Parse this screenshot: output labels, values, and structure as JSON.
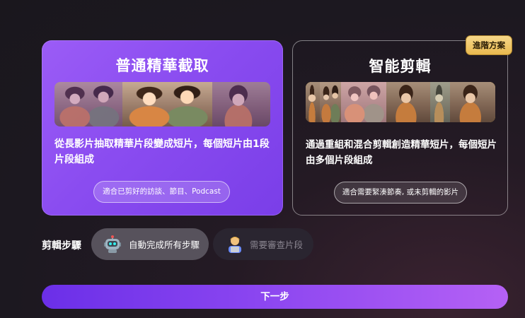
{
  "cards": {
    "basic": {
      "title": "普通精華截取",
      "description": "從長影片抽取精華片段變成短片，每個短片由1段片段組成",
      "pill": "適合已剪好的訪談、節目、Podcast"
    },
    "smart": {
      "badge": "進階方案",
      "title": "智能剪輯",
      "description": "通過重組和混合剪輯創造精華短片，每個短片由多個片段組成",
      "pill": "適合需要緊湊節奏, 或未剪輯的影片"
    }
  },
  "steps": {
    "label": "剪輯步驟",
    "auto_label": "自動完成所有步驟",
    "review_label": "需要審查片段",
    "auto_icon": "robot-icon",
    "review_icon": "person-reviewing-icon"
  },
  "next_button": "下一步",
  "colors": {
    "accent": "#8a45f0",
    "badge": "#f0c765",
    "frame_yellow": "#f3bf2c",
    "frame_pink": "#f3a6d4",
    "frame_cyan": "#3ad1d1"
  }
}
